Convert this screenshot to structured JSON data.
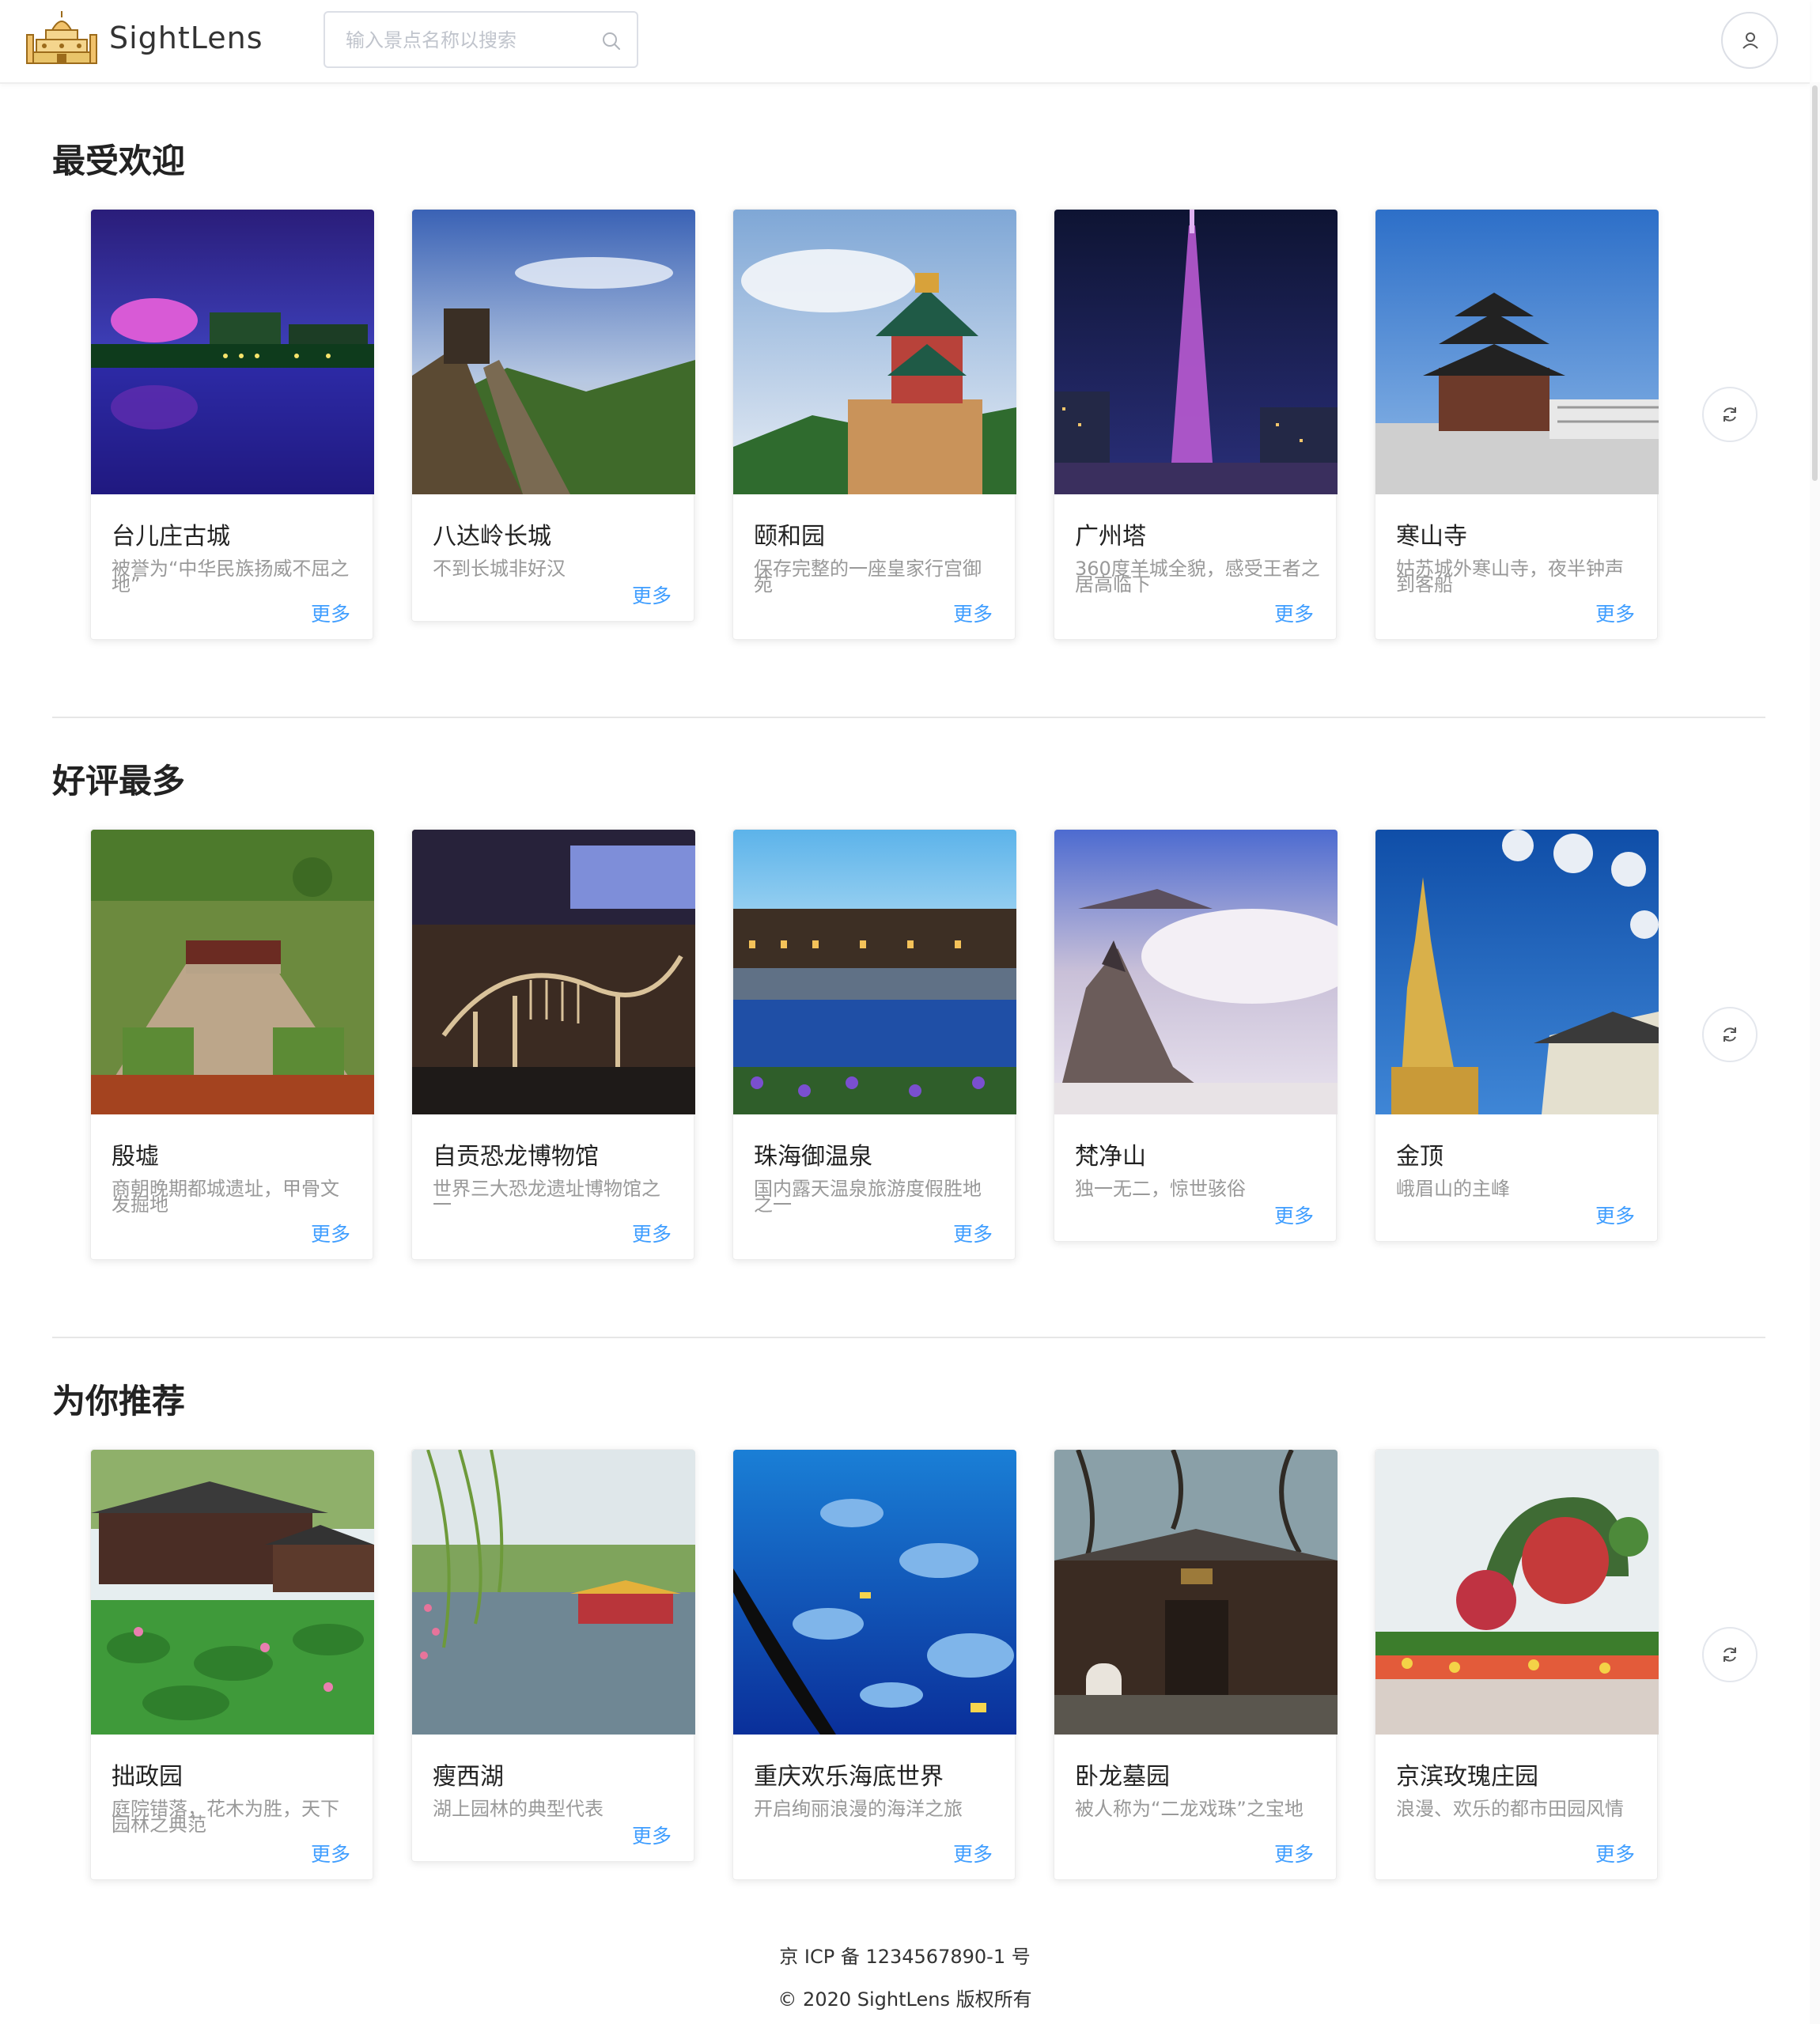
{
  "header": {
    "brand": "SightLens",
    "search_placeholder": "输入景点名称以搜索"
  },
  "sections": [
    {
      "title": "最受欢迎",
      "cards": [
        {
          "name": "台儿庄古城",
          "desc": "被誉为“中华民族扬威不屈之地”",
          "more": "更多"
        },
        {
          "name": "八达岭长城",
          "desc": "不到长城非好汉",
          "more": "更多"
        },
        {
          "name": "颐和园",
          "desc": "保存完整的一座皇家行宫御苑",
          "more": "更多"
        },
        {
          "name": "广州塔",
          "desc": "360度羊城全貌，感受王者之居高临下",
          "more": "更多"
        },
        {
          "name": "寒山寺",
          "desc": "姑苏城外寒山寺，夜半钟声到客船",
          "more": "更多"
        }
      ]
    },
    {
      "title": "好评最多",
      "cards": [
        {
          "name": "殷墟",
          "desc": "商朝晚期都城遗址，甲骨文发掘地",
          "more": "更多"
        },
        {
          "name": "自贡恐龙博物馆",
          "desc": "世界三大恐龙遗址博物馆之一",
          "more": "更多"
        },
        {
          "name": "珠海御温泉",
          "desc": "国内露天温泉旅游度假胜地之一",
          "more": "更多"
        },
        {
          "name": "梵净山",
          "desc": "独一无二，惊世骇俗",
          "more": "更多"
        },
        {
          "name": "金顶",
          "desc": "峨眉山的主峰",
          "more": "更多"
        }
      ]
    },
    {
      "title": "为你推荐",
      "cards": [
        {
          "name": "拙政园",
          "desc": "庭院错落，花木为胜，天下园林之典范",
          "more": "更多"
        },
        {
          "name": "瘦西湖",
          "desc": "湖上园林的典型代表",
          "more": "更多"
        },
        {
          "name": "重庆欢乐海底世界",
          "desc": "开启绚丽浪漫的海洋之旅",
          "more": "更多"
        },
        {
          "name": "卧龙墓园",
          "desc": "被人称为“二龙戏珠”之宝地",
          "more": "更多"
        },
        {
          "name": "京滨玫瑰庄园",
          "desc": "浪漫、欢乐的都市田园风情",
          "more": "更多"
        }
      ]
    }
  ],
  "footer": {
    "icp": "京 ICP 备 1234567890-1 号",
    "copyright": "© 2020 SightLens 版权所有"
  },
  "colors": {
    "link": "#409eff",
    "title": "#222222",
    "desc": "#999999"
  }
}
